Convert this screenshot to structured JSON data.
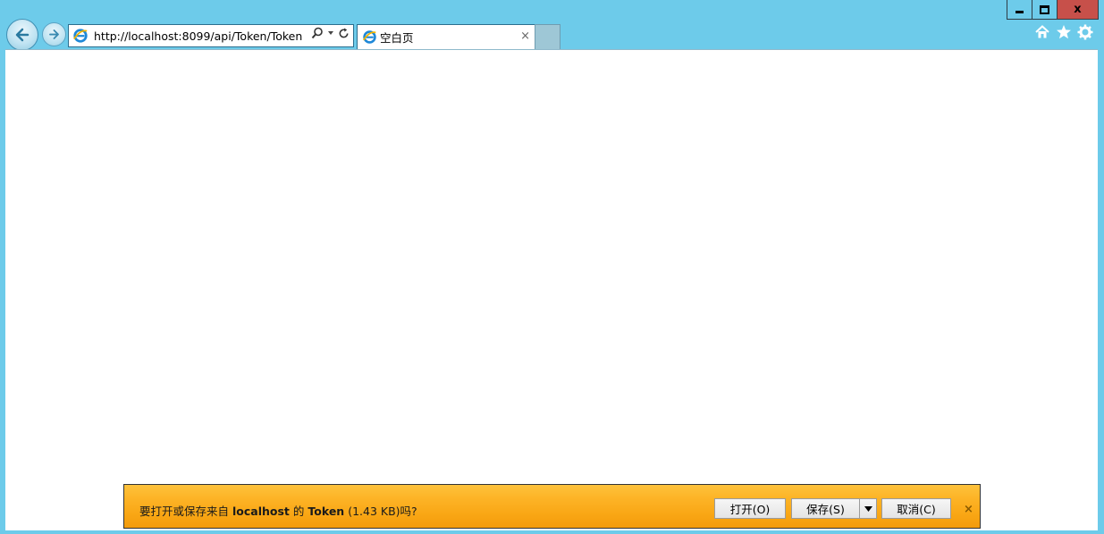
{
  "window": {
    "minimize_icon": "minimize-icon",
    "maximize_icon": "maximize-icon",
    "close_label": "x"
  },
  "nav": {
    "back_icon": "back-arrow-icon",
    "forward_icon": "forward-arrow-icon"
  },
  "address_bar": {
    "url": "http://localhost:8099/api/Token/Token",
    "search_icon": "search-icon",
    "dropdown_icon": "chevron-down-icon",
    "refresh_icon": "refresh-icon"
  },
  "tab": {
    "title": "空白页",
    "close": "×"
  },
  "toolbar": {
    "home_icon": "home-icon",
    "favorites_icon": "star-icon",
    "settings_icon": "gear-icon"
  },
  "download_bar": {
    "prefix": "要打开或保存来自",
    "host": "localhost",
    "middle": "的",
    "filename": "Token",
    "size": "(1.43 KB)",
    "suffix": "吗?",
    "open_label": "打开(O)",
    "save_label": "保存(S)",
    "cancel_label": "取消(C)",
    "close_label": "×"
  },
  "colors": {
    "frame": "#6dcbea",
    "close_button": "#c7504a",
    "notification": "#fdb427"
  }
}
